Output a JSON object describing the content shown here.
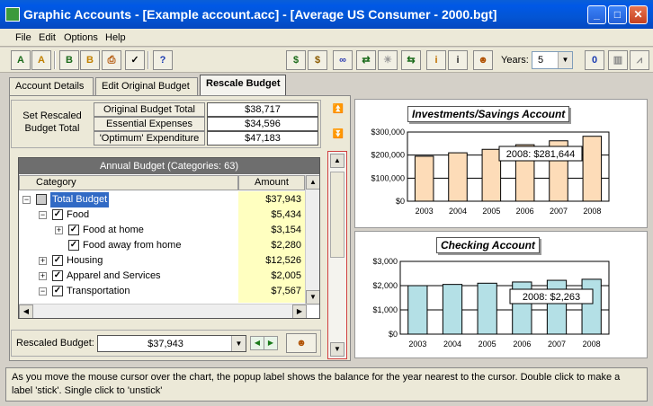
{
  "window": {
    "title": "Graphic Accounts - [Example account.acc] - [Average US Consumer - 2000.bgt]"
  },
  "menu": [
    "File",
    "Edit",
    "Options",
    "Help"
  ],
  "toolbar": {
    "years_label": "Years:",
    "years_value": "5"
  },
  "tabs": [
    "Account Details",
    "Edit Original Budget",
    "Rescale Budget"
  ],
  "budget": {
    "set_label": "Set Rescaled Budget Total",
    "rows": [
      {
        "label": "Original Budget Total",
        "value": "$38,717"
      },
      {
        "label": "Essential Expenses",
        "value": "$34,596"
      },
      {
        "label": "'Optimum' Expenditure",
        "value": "$47,183"
      }
    ]
  },
  "tree": {
    "header": "Annual Budget (Categories:  63)",
    "col_category": "Category",
    "col_amount": "Amount",
    "rows": [
      {
        "label": "Total Budget",
        "amount": "$37,943",
        "level": 0,
        "expander": "−",
        "checked": false,
        "selected": true
      },
      {
        "label": "Food",
        "amount": "$5,434",
        "level": 1,
        "expander": "−",
        "checked": true
      },
      {
        "label": "Food at home",
        "amount": "$3,154",
        "level": 2,
        "expander": "+",
        "checked": true
      },
      {
        "label": "Food away from home",
        "amount": "$2,280",
        "level": 2,
        "expander": "",
        "checked": true
      },
      {
        "label": "Housing",
        "amount": "$12,526",
        "level": 1,
        "expander": "+",
        "checked": true
      },
      {
        "label": "Apparel and Services",
        "amount": "$2,005",
        "level": 1,
        "expander": "+",
        "checked": true
      },
      {
        "label": "Transportation",
        "amount": "$7,567",
        "level": 1,
        "expander": "−",
        "checked": true
      }
    ]
  },
  "rescaled": {
    "label": "Rescaled Budget:",
    "value": "$37,943"
  },
  "chart_data": [
    {
      "type": "bar",
      "title": "Investments/Savings Account",
      "categories": [
        "2003",
        "2004",
        "2005",
        "2006",
        "2007",
        "2008"
      ],
      "values": [
        195000,
        210000,
        225000,
        245000,
        262000,
        281644
      ],
      "ylim": [
        0,
        300000
      ],
      "yticks": [
        "$0",
        "$100,000",
        "$200,000",
        "$300,000"
      ],
      "popup": "2008: $281,644",
      "bar_color": "#fddcb8"
    },
    {
      "type": "bar",
      "title": "Checking Account",
      "categories": [
        "2003",
        "2004",
        "2005",
        "2006",
        "2007",
        "2008"
      ],
      "values": [
        2000,
        2050,
        2100,
        2150,
        2220,
        2263
      ],
      "ylim": [
        0,
        3000
      ],
      "yticks": [
        "$0",
        "$1,000",
        "$2,000",
        "$3,000"
      ],
      "popup": "2008: $2,263",
      "bar_color": "#b4e0e6"
    }
  ],
  "status": "As you move the mouse cursor over the chart, the popup label shows the balance for the year nearest to the cursor.  Double click to make a label 'stick'. Single click to 'unstick'"
}
